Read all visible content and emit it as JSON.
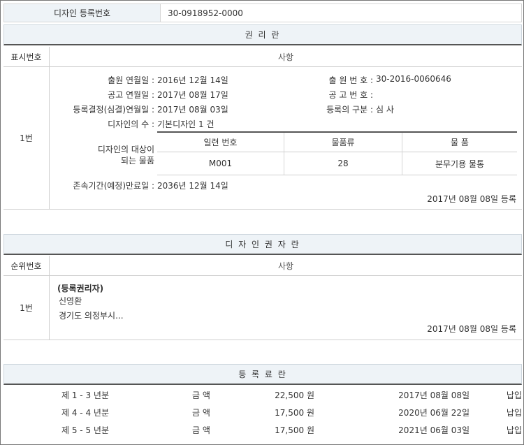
{
  "registration": {
    "label": "디자인 등록번호",
    "value": "30-0918952-0000"
  },
  "rights": {
    "title": "권 리 란",
    "col_num": "표시번호",
    "col_items": "사항",
    "row_num": "1번",
    "fields": {
      "app_date_label": "출원 연월일 :",
      "app_date_value": "2016년 12월 14일",
      "app_no_label": "출 원 번 호 :",
      "app_no_value": "30-2016-0060646",
      "pub_date_label": "공고 연월일 :",
      "pub_date_value": "2017년 08월 17일",
      "pub_no_label": "공 고 번 호 :",
      "pub_no_value": "",
      "decision_label": "등록결정(심결)연월일 :",
      "decision_value": "2017년 08월 03일",
      "reg_type_label": "등록의 구분 :",
      "reg_type_value": "심 사",
      "count_label": "디자인의 수 :",
      "count_value": "기본디자인 1 건",
      "object_label_1": "디자인의 대상이",
      "object_label_2": "되는 물품",
      "expiry_label": "존속기간(예정)만료일 :",
      "expiry_value": "2036년 12월 14일"
    },
    "object_table": {
      "headers": [
        "일련 번호",
        "물품류",
        "물 품"
      ],
      "rows": [
        [
          "M001",
          "28",
          "분무기용 물통"
        ]
      ]
    },
    "registered": "2017년 08월 08일 등록"
  },
  "holders": {
    "title": "디 자 인 권 자 란",
    "col_num": "순위번호",
    "col_items": "사항",
    "row_num": "1번",
    "heading": "(등록권리자)",
    "name": "신영환",
    "address": "경기도 의정부시...",
    "registered": "2017년 08월 08일 등록"
  },
  "fees": {
    "title": "등 록 료 란",
    "rows": [
      {
        "period": "제 1 - 3 년분",
        "label": "금 액",
        "amount": "22,500 원",
        "date": "2017년 08월 08일",
        "status": "납입"
      },
      {
        "period": "제 4 - 4 년분",
        "label": "금 액",
        "amount": "17,500 원",
        "date": "2020년 06월 22일",
        "status": "납입"
      },
      {
        "period": "제 5 - 5 년분",
        "label": "금 액",
        "amount": "17,500 원",
        "date": "2021년 06월 03일",
        "status": "납입"
      }
    ]
  }
}
